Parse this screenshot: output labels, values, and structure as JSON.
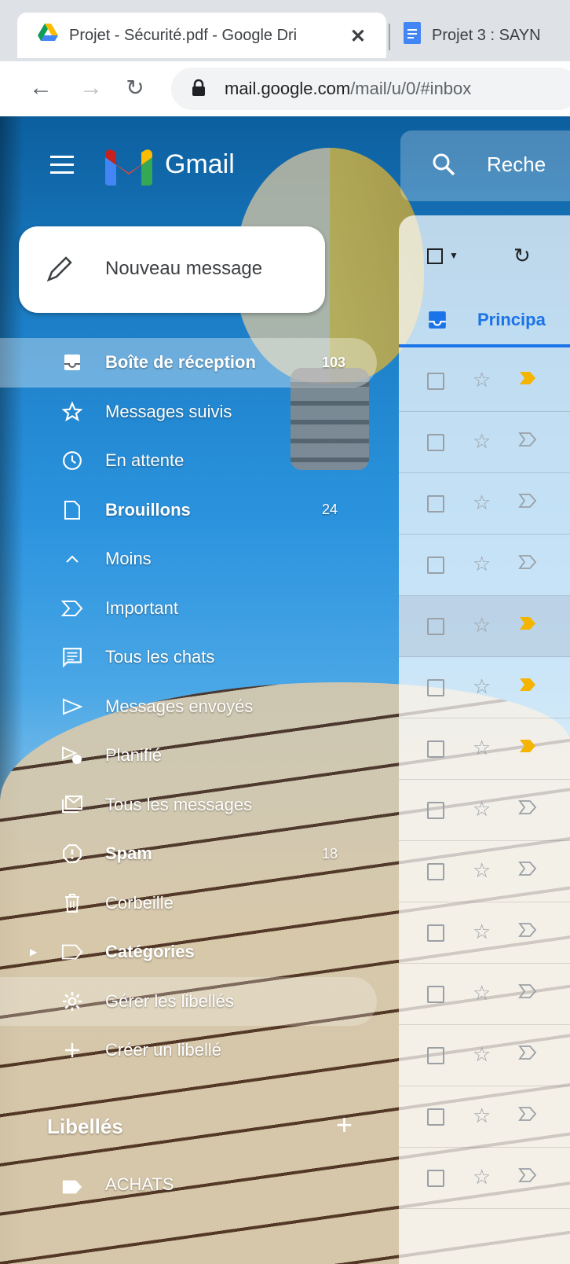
{
  "browser": {
    "tabs": [
      {
        "title": "Projet - Sécurité.pdf - Google Dri",
        "icon": "google-drive-icon"
      },
      {
        "title": "Projet 3 : SAYN",
        "icon": "google-docs-icon"
      }
    ],
    "url_host": "mail.google.com",
    "url_path": "/mail/u/0/#inbox"
  },
  "gmail": {
    "logo_text": "Gmail",
    "search_placeholder": "Reche",
    "compose_label": "Nouveau message",
    "nav": [
      {
        "label": "Boîte de réception",
        "count": "103",
        "icon": "inbox-icon",
        "bold": true,
        "selected": true
      },
      {
        "label": "Messages suivis",
        "count": "",
        "icon": "star-icon"
      },
      {
        "label": "En attente",
        "count": "",
        "icon": "clock-icon"
      },
      {
        "label": "Brouillons",
        "count": "24",
        "icon": "draft-icon",
        "bold": true
      },
      {
        "label": "Moins",
        "count": "",
        "icon": "chevron-up-icon"
      },
      {
        "label": "Important",
        "count": "",
        "icon": "important-icon"
      },
      {
        "label": "Tous les chats",
        "count": "",
        "icon": "chat-icon"
      },
      {
        "label": "Messages envoyés",
        "count": "",
        "icon": "send-icon"
      },
      {
        "label": "Planifié",
        "count": "",
        "icon": "scheduled-icon"
      },
      {
        "label": "Tous les messages",
        "count": "",
        "icon": "all-mail-icon"
      },
      {
        "label": "Spam",
        "count": "18",
        "icon": "spam-icon",
        "bold": true
      },
      {
        "label": "Corbeille",
        "count": "",
        "icon": "trash-icon"
      },
      {
        "label": "Catégories",
        "count": "",
        "icon": "label-icon",
        "bold": true
      },
      {
        "label": "Gérer les libellés",
        "count": "",
        "icon": "gear-icon"
      },
      {
        "label": "Créer un libellé",
        "count": "",
        "icon": "plus-icon"
      }
    ],
    "labels_heading": "Libellés",
    "labels": [
      {
        "label": "ACHATS",
        "icon": "label-filled-icon"
      }
    ],
    "tab_label": "Principa",
    "accent": "#1a73e8",
    "important_color": "#f4b400"
  },
  "mail_rows": [
    {
      "important": true
    },
    {
      "important": false
    },
    {
      "important": false
    },
    {
      "important": false
    },
    {
      "important": true,
      "highlight": true
    },
    {
      "important": true
    },
    {
      "important": true
    },
    {
      "important": false
    },
    {
      "important": false
    },
    {
      "important": false
    },
    {
      "important": false
    },
    {
      "important": false
    },
    {
      "important": false
    },
    {
      "important": false
    }
  ]
}
